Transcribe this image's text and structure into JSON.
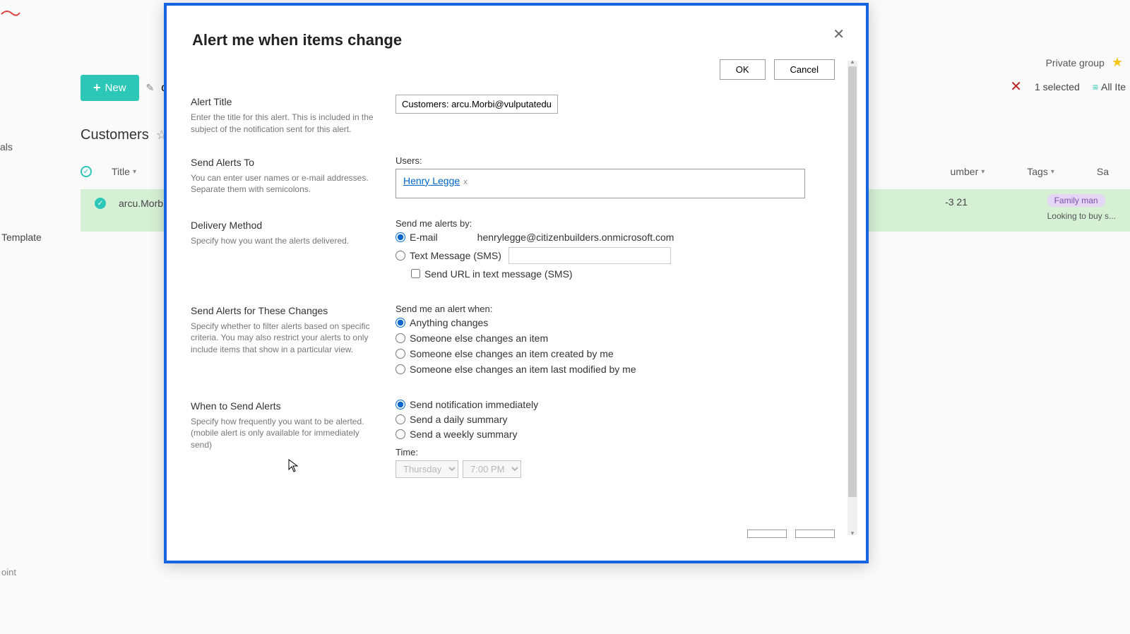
{
  "background": {
    "privateGroup": "Private group",
    "newButton": "New",
    "editText": "d",
    "selectedCount": "1 selected",
    "allItems": "All Ite",
    "listTitle": "Customers",
    "titleColumn": "Title",
    "rowText": "arcu.Morb @",
    "numberCol": "umber",
    "tagsCol": "Tags",
    "saCol": "Sa",
    "tag1": "Family man",
    "tag2": "Looking to buy s...",
    "rowNum": "-3 21",
    "navAls": "als",
    "template": "Template",
    "point": "oint"
  },
  "modal": {
    "title": "Alert me when items change",
    "ok": "OK",
    "cancel": "Cancel",
    "sections": {
      "alertTitle": {
        "label": "Alert Title",
        "desc": "Enter the title for this alert. This is included in the subject of the notification sent for this alert.",
        "value": "Customers: arcu.Morbi@vulputateduinec."
      },
      "sendTo": {
        "label": "Send Alerts To",
        "desc": "You can enter user names or e-mail addresses. Separate them with semicolons.",
        "usersLabel": "Users:",
        "userName": "Henry Legge"
      },
      "delivery": {
        "label": "Delivery Method",
        "desc": "Specify how you want the alerts delivered.",
        "sendBy": "Send me alerts by:",
        "emailOpt": "E-mail",
        "emailAddr": "henrylegge@citizenbuilders.onmicrosoft.com",
        "smsOpt": "Text Message (SMS)",
        "urlSms": "Send URL in text message (SMS)"
      },
      "changes": {
        "label": "Send Alerts for These Changes",
        "desc": "Specify whether to filter alerts based on specific criteria. You may also restrict your alerts to only include items that show in a particular view.",
        "when": "Send me an alert when:",
        "opt1": "Anything changes",
        "opt2": "Someone else changes an item",
        "opt3": "Someone else changes an item created by me",
        "opt4": "Someone else changes an item last modified by me"
      },
      "freq": {
        "label": "When to Send Alerts",
        "desc": "Specify how frequently you want to be alerted. (mobile alert is only available for immediately send)",
        "opt1": "Send notification immediately",
        "opt2": "Send a daily summary",
        "opt3": "Send a weekly summary",
        "timeLabel": "Time:",
        "day": "Thursday",
        "time": "7:00 PM"
      }
    }
  }
}
